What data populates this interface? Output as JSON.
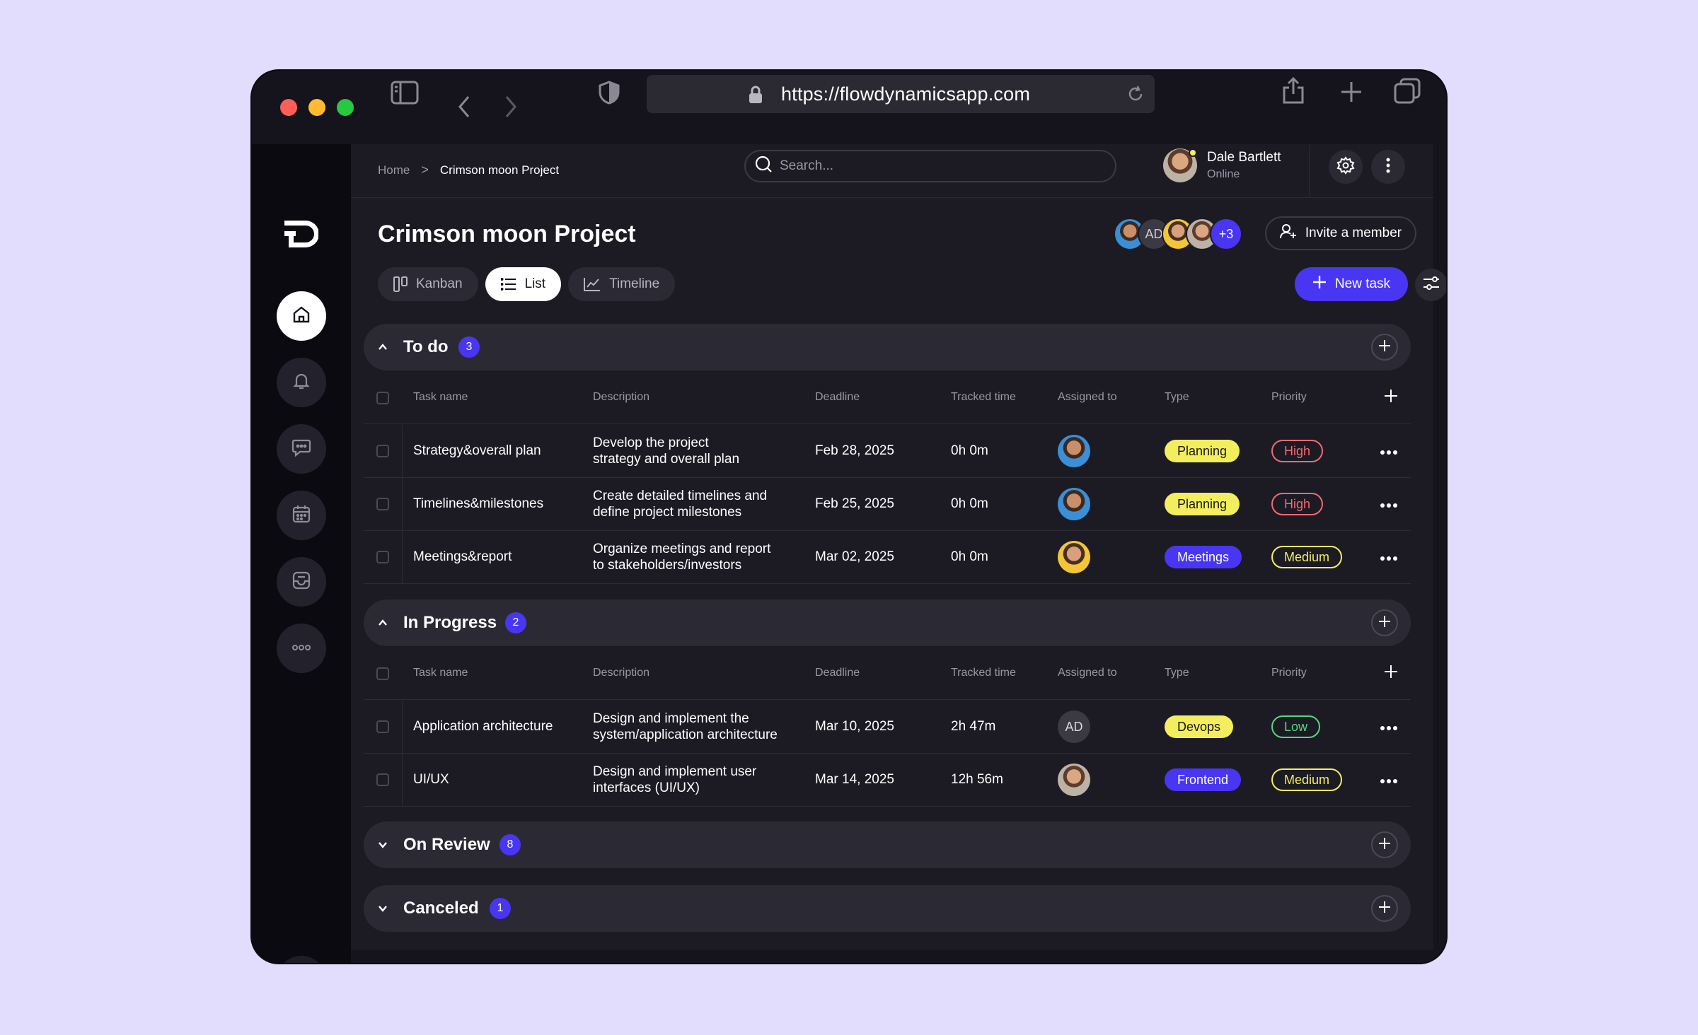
{
  "browser": {
    "url": "https://flowdynamicsapp.com"
  },
  "breadcrumb": {
    "home": "Home",
    "separator": ">",
    "current": "Crimson moon Project"
  },
  "search": {
    "placeholder": "Search..."
  },
  "user": {
    "name": "Dale Bartlett",
    "status": "Online",
    "status_color": "#f3ee5e"
  },
  "project": {
    "title": "Crimson moon Project",
    "member_initials": "AD",
    "more_members": "+3",
    "invite_label": "Invite a member"
  },
  "views": {
    "kanban": "Kanban",
    "list": "List",
    "timeline": "Timeline",
    "active": "list"
  },
  "new_task_label": "New task",
  "columns": {
    "task_name": "Task name",
    "description": "Description",
    "deadline": "Deadline",
    "tracked_time": "Tracked time",
    "assigned_to": "Assigned to",
    "type": "Type",
    "priority": "Priority"
  },
  "colors": {
    "accent": "#4936f3",
    "type_planning": "#f3ee5e",
    "type_devops": "#f3ee5e",
    "type_meetings": "#4936f3",
    "type_frontend": "#4936f3",
    "prio_high": "#f06a73",
    "prio_medium": "#f3ee5e",
    "prio_low": "#5ad47e"
  },
  "groups": {
    "todo": {
      "title": "To do",
      "count": "3",
      "expanded": true,
      "tasks": [
        {
          "name": "Strategy&overall plan",
          "desc1": "Develop the project",
          "desc2": "strategy and overall plan",
          "deadline": "Feb 28, 2025",
          "tracked": "0h 0m",
          "assignee": "",
          "type": "Planning",
          "priority": "High"
        },
        {
          "name": "Timelines&milestones",
          "desc1": "Create detailed timelines and",
          "desc2": "define project milestones",
          "deadline": "Feb 25, 2025",
          "tracked": "0h 0m",
          "assignee": "",
          "type": "Planning",
          "priority": "High"
        },
        {
          "name": "Meetings&report",
          "desc1": "Organize meetings and report",
          "desc2": "to stakeholders/investors",
          "deadline": "Mar 02, 2025",
          "tracked": "0h 0m",
          "assignee": "",
          "type": "Meetings",
          "priority": "Medium"
        }
      ]
    },
    "in_progress": {
      "title": "In Progress",
      "count": "2",
      "expanded": true,
      "tasks": [
        {
          "name": "Application architecture",
          "desc1": "Design and implement the",
          "desc2": "system/application architecture",
          "deadline": "Mar 10, 2025",
          "tracked": "2h 47m",
          "assignee": "AD",
          "type": "Devops",
          "priority": "Low"
        },
        {
          "name": "UI/UX",
          "desc1": "Design and implement user",
          "desc2": "interfaces (UI/UX)",
          "deadline": "Mar 14, 2025",
          "tracked": "12h 56m",
          "assignee": "",
          "type": "Frontend",
          "priority": "Medium"
        }
      ]
    },
    "on_review": {
      "title": "On Review",
      "count": "8",
      "expanded": false
    },
    "canceled": {
      "title": "Canceled",
      "count": "1",
      "expanded": false
    }
  },
  "icons": {
    "sidebar_nav": [
      "home-icon",
      "bell-icon",
      "chat-icon",
      "calendar-icon",
      "inbox-icon",
      "more-horizontal-icon"
    ],
    "toolbar": [
      "sidebar-toggle-icon",
      "chevron-left-icon",
      "chevron-right-icon",
      "shield-icon",
      "lock-icon",
      "reload-icon",
      "share-icon",
      "plus-icon",
      "tabs-icon"
    ]
  }
}
